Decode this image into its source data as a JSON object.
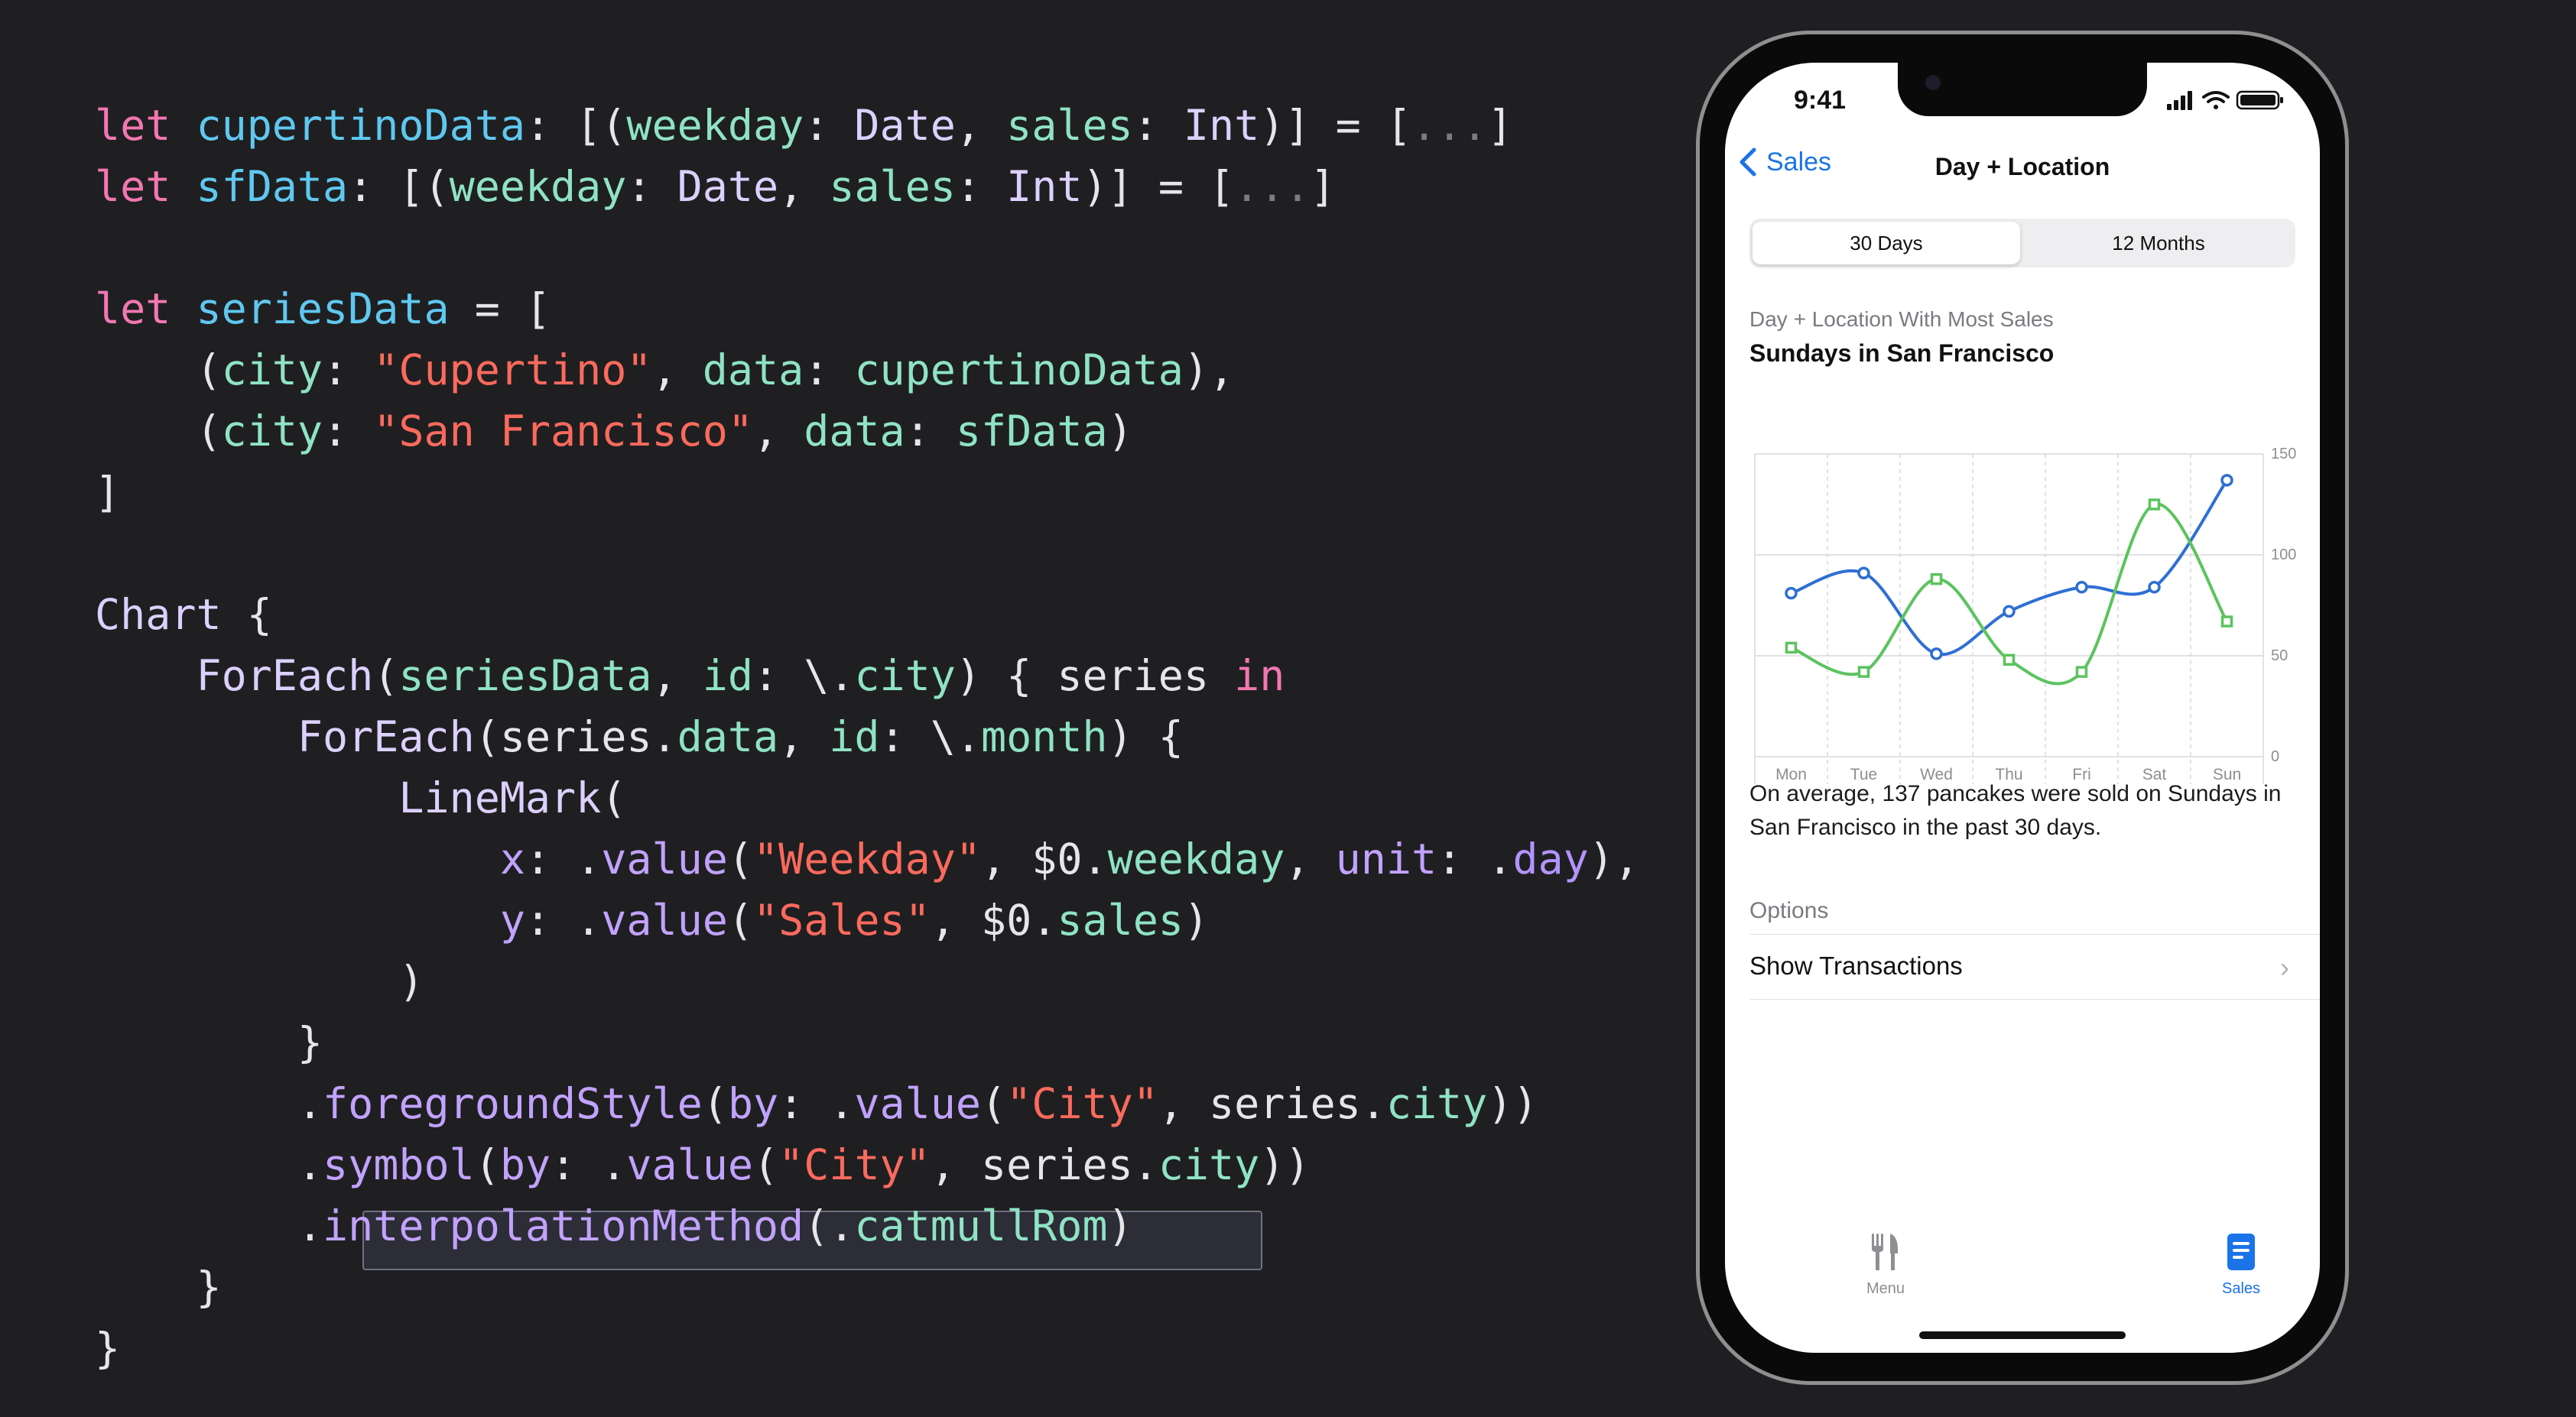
{
  "code": {
    "lines": [
      [
        [
          "kw",
          "let"
        ],
        [
          "plain",
          " "
        ],
        [
          "id",
          "cupertinoData"
        ],
        [
          "plain",
          ": [("
        ],
        [
          "prop",
          "weekday"
        ],
        [
          "plain",
          ": "
        ],
        [
          "ty",
          "Date"
        ],
        [
          "plain",
          ", "
        ],
        [
          "prop",
          "sales"
        ],
        [
          "plain",
          ": "
        ],
        [
          "ty",
          "Int"
        ],
        [
          "plain",
          ")] = ["
        ],
        [
          "dim",
          "..."
        ],
        [
          "plain",
          "]"
        ]
      ],
      [
        [
          "kw",
          "let"
        ],
        [
          "plain",
          " "
        ],
        [
          "id",
          "sfData"
        ],
        [
          "plain",
          ": [("
        ],
        [
          "prop",
          "weekday"
        ],
        [
          "plain",
          ": "
        ],
        [
          "ty",
          "Date"
        ],
        [
          "plain",
          ", "
        ],
        [
          "prop",
          "sales"
        ],
        [
          "plain",
          ": "
        ],
        [
          "ty",
          "Int"
        ],
        [
          "plain",
          ")] = ["
        ],
        [
          "dim",
          "..."
        ],
        [
          "plain",
          "]"
        ]
      ],
      [],
      [
        [
          "kw",
          "let"
        ],
        [
          "plain",
          " "
        ],
        [
          "id",
          "seriesData"
        ],
        [
          "plain",
          " = ["
        ]
      ],
      [
        [
          "plain",
          "    ("
        ],
        [
          "prop",
          "city"
        ],
        [
          "plain",
          ": "
        ],
        [
          "str",
          "\"Cupertino\""
        ],
        [
          "plain",
          ", "
        ],
        [
          "prop",
          "data"
        ],
        [
          "plain",
          ": "
        ],
        [
          "prop",
          "cupertinoData"
        ],
        [
          "plain",
          "),"
        ]
      ],
      [
        [
          "plain",
          "    ("
        ],
        [
          "prop",
          "city"
        ],
        [
          "plain",
          ": "
        ],
        [
          "str",
          "\"San Francisco\""
        ],
        [
          "plain",
          ", "
        ],
        [
          "prop",
          "data"
        ],
        [
          "plain",
          ": "
        ],
        [
          "prop",
          "sfData"
        ],
        [
          "plain",
          ")"
        ]
      ],
      [
        [
          "plain",
          "]"
        ]
      ],
      [],
      [
        [
          "ty",
          "Chart"
        ],
        [
          "plain",
          " {"
        ]
      ],
      [
        [
          "plain",
          "    "
        ],
        [
          "ty",
          "ForEach"
        ],
        [
          "plain",
          "("
        ],
        [
          "prop",
          "seriesData"
        ],
        [
          "plain",
          ", "
        ],
        [
          "prop",
          "id"
        ],
        [
          "plain",
          ": \\."
        ],
        [
          "prop",
          "city"
        ],
        [
          "plain",
          ") { series "
        ],
        [
          "kw",
          "in"
        ]
      ],
      [
        [
          "plain",
          "        "
        ],
        [
          "ty",
          "ForEach"
        ],
        [
          "plain",
          "(series."
        ],
        [
          "prop",
          "data"
        ],
        [
          "plain",
          ", "
        ],
        [
          "prop",
          "id"
        ],
        [
          "plain",
          ": \\."
        ],
        [
          "prop",
          "month"
        ],
        [
          "plain",
          ") {"
        ]
      ],
      [
        [
          "plain",
          "            "
        ],
        [
          "ty",
          "LineMark"
        ],
        [
          "plain",
          "("
        ]
      ],
      [
        [
          "plain",
          "                "
        ],
        [
          "fn",
          "x"
        ],
        [
          "plain",
          ": ."
        ],
        [
          "fn",
          "value"
        ],
        [
          "plain",
          "("
        ],
        [
          "str",
          "\"Weekday\""
        ],
        [
          "plain",
          ", $0."
        ],
        [
          "prop",
          "weekday"
        ],
        [
          "plain",
          ", "
        ],
        [
          "fn",
          "unit"
        ],
        [
          "plain",
          ": ."
        ],
        [
          "mem",
          "day"
        ],
        [
          "plain",
          "),"
        ]
      ],
      [
        [
          "plain",
          "                "
        ],
        [
          "fn",
          "y"
        ],
        [
          "plain",
          ": ."
        ],
        [
          "fn",
          "value"
        ],
        [
          "plain",
          "("
        ],
        [
          "str",
          "\"Sales\""
        ],
        [
          "plain",
          ", $0."
        ],
        [
          "prop",
          "sales"
        ],
        [
          "plain",
          ")"
        ]
      ],
      [
        [
          "plain",
          "            )"
        ]
      ],
      [
        [
          "plain",
          "        }"
        ]
      ],
      [
        [
          "plain",
          "        ."
        ],
        [
          "fn",
          "foregroundStyle"
        ],
        [
          "plain",
          "("
        ],
        [
          "fn",
          "by"
        ],
        [
          "plain",
          ": ."
        ],
        [
          "fn",
          "value"
        ],
        [
          "plain",
          "("
        ],
        [
          "str",
          "\"City\""
        ],
        [
          "plain",
          ", series."
        ],
        [
          "prop",
          "city"
        ],
        [
          "plain",
          "))"
        ]
      ],
      [
        [
          "plain",
          "        ."
        ],
        [
          "fn",
          "symbol"
        ],
        [
          "plain",
          "("
        ],
        [
          "fn",
          "by"
        ],
        [
          "plain",
          ": ."
        ],
        [
          "fn",
          "value"
        ],
        [
          "plain",
          "("
        ],
        [
          "str",
          "\"City\""
        ],
        [
          "plain",
          ", series."
        ],
        [
          "prop",
          "city"
        ],
        [
          "plain",
          "))"
        ]
      ],
      [
        [
          "plain",
          "        ."
        ],
        [
          "fn",
          "interpolationMethod"
        ],
        [
          "plain",
          "(."
        ],
        [
          "prop",
          "catmullRom"
        ],
        [
          "plain",
          ")"
        ]
      ],
      [
        [
          "plain",
          "    }"
        ]
      ],
      [
        [
          "plain",
          "}"
        ]
      ]
    ]
  },
  "phone": {
    "time": "9:41",
    "nav": {
      "back_label": "Sales",
      "title": "Day + Location"
    },
    "segments": {
      "left": "30 Days",
      "right": "12 Months",
      "selected": "30 Days"
    },
    "chart_subtitle": "Day + Location With Most Sales",
    "chart_headline": "Sundays in San Francisco",
    "description": "On average, 137 pancakes were sold on Sundays in San Francisco in the past 30 days.",
    "options_label": "Options",
    "options_row": "Show Transactions",
    "tabs": [
      {
        "label": "Menu",
        "icon": "fork-knife-icon",
        "active": false
      },
      {
        "label": "Sales",
        "icon": "document-icon",
        "active": true
      }
    ],
    "colors": {
      "accent": "#1a73e8",
      "sf": "#2f6fd3",
      "cupertino": "#5cc35f"
    }
  },
  "chart_data": {
    "type": "line",
    "categories": [
      "Mon",
      "Tue",
      "Wed",
      "Thu",
      "Fri",
      "Sat",
      "Sun"
    ],
    "series": [
      {
        "name": "San Francisco",
        "values": [
          81,
          91,
          51,
          72,
          84,
          84,
          137
        ],
        "symbol": "circle",
        "color": "#2f6fd3"
      },
      {
        "name": "Cupertino",
        "values": [
          54,
          42,
          88,
          48,
          42,
          125,
          67
        ],
        "symbol": "square",
        "color": "#5cc35f"
      }
    ],
    "y_ticks": [
      "0",
      "50",
      "100",
      "150"
    ],
    "ylim": [
      0,
      150
    ],
    "grid": true,
    "legend_position": "bottom-left",
    "interpolation": "catmullRom"
  }
}
